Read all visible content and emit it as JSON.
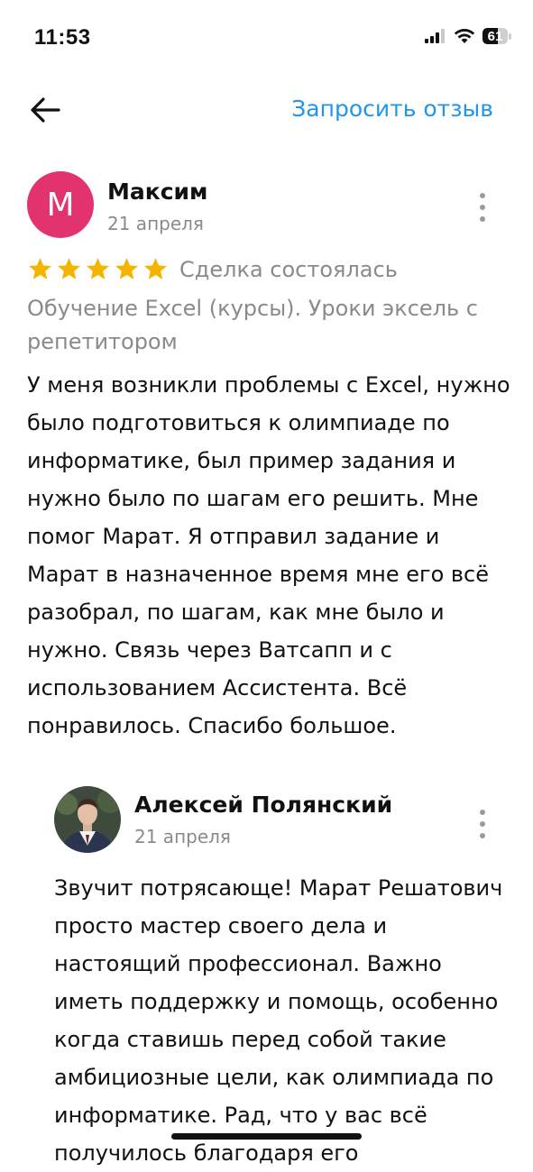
{
  "status_bar": {
    "time": "11:53",
    "battery_level": "61",
    "battery_fraction": 0.61
  },
  "header": {
    "back_icon": "arrow-left-icon",
    "request_review_label": "Запросить отзыв"
  },
  "review": {
    "avatar_letter": "M",
    "avatar_color": "#e3336f",
    "author": "Максим",
    "date": "21 апреля",
    "rating": 5,
    "star_color": "#f5b400",
    "deal_status": "Сделка состоялась",
    "service": "Обучение Excel (курсы). Уроки эксель с репетитором",
    "text": "У меня возникли проблемы с Excel, нужно было подготовиться к олимпиаде по информатике,  был пример задания и нужно было по шагам его решить.  Мне помог Марат. Я отправил задание и Марат в назначенное время мне его всё разобрал, по шагам, как мне было и нужно.  Связь через Ватсапп и с использованием Ассистента. Всё понравилось. Спасибо большое."
  },
  "reply": {
    "author": "Алексей Полянский",
    "date": "21 апреля",
    "avatar_icon": "profile-photo",
    "text": "Звучит потрясающе! Марат Решатович просто мастер своего дела и настоящий профессионал. Важно иметь поддержку и помощь, особенно когда ставишь перед собой такие амбициозные цели, как олимпиада по информатике. Рад, что у вас всё получилось благодаря его"
  },
  "colors": {
    "accent": "#2196e8",
    "muted_text": "#8a8a8a"
  }
}
